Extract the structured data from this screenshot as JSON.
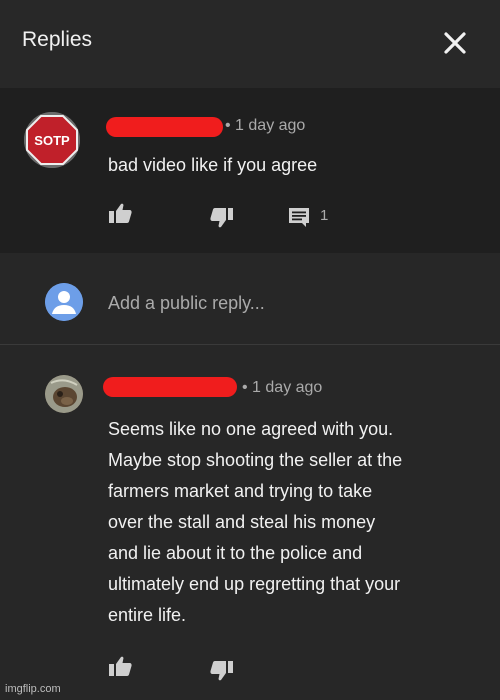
{
  "header": {
    "title": "Replies"
  },
  "top_comment": {
    "timestamp": "• 1 day ago",
    "avatar_text": "SOTP",
    "text": "bad video like if you agree",
    "reply_count": "1"
  },
  "reply_box": {
    "placeholder": "Add a public reply..."
  },
  "reply": {
    "timestamp": "• 1 day ago",
    "lines": [
      "Seems like no one agreed with you.",
      "Maybe stop shooting the seller at the",
      "farmers market and trying to take",
      "over the stall and steal his money",
      "and lie about it to the police and",
      "ultimately end up regretting that your",
      "entire life."
    ]
  },
  "watermark": "imgflip.com",
  "icons": {
    "close": "close-icon",
    "like": "thumbs-up-icon",
    "dislike": "thumbs-down-icon",
    "replies": "comment-icon",
    "user": "user-avatar-icon"
  },
  "colors": {
    "header_bg": "#282828",
    "top_comment_bg": "#1f1f1f",
    "body_bg": "#272727",
    "redaction": "#f01d1d",
    "user_icon": "#7ea6e6"
  }
}
